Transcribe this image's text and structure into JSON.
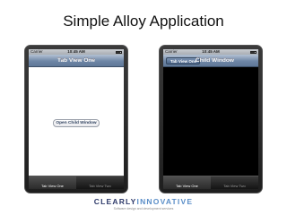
{
  "slide": {
    "title": "Simple Alloy Application"
  },
  "devices": [
    {
      "status": {
        "carrier": "Carrier",
        "time": "10:45 AM"
      },
      "nav_title": "Tab View One",
      "button_label": "Open Child Window",
      "tabs": [
        "Tab View One",
        "Tab View Two"
      ],
      "active_tab": 0
    },
    {
      "status": {
        "carrier": "Carrier",
        "time": "10:45 AM"
      },
      "back_button_label": "Tab View One",
      "nav_title": "Child Window",
      "tabs": [
        "Tab View One",
        "Tab View Two"
      ],
      "active_tab": 0
    }
  ],
  "footer": {
    "logo_part1": "CLEARLY",
    "logo_part2": "INNOVATIVE",
    "tagline": "Software design and development services"
  },
  "colors": {
    "navbar": "#6e86a6",
    "tabbar": "#141414",
    "logo": "#2f3b6b",
    "logo_accent": "#5a8ec8"
  }
}
